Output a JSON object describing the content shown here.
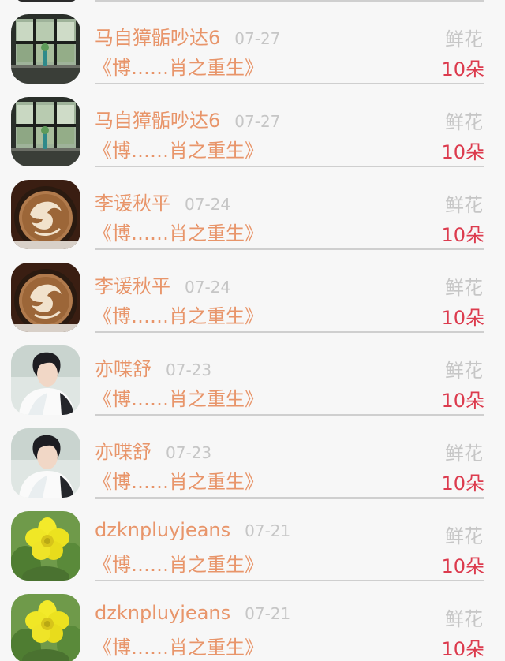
{
  "list": {
    "items": [
      {
        "name": "马自獐骺吵达6",
        "date": "07-27",
        "title": "《博……肖之重生》",
        "gift": "鲜花",
        "amount": "10朵",
        "avatar_icon": "window-plant-avatar"
      },
      {
        "name": "马自獐骺吵达6",
        "date": "07-27",
        "title": "《博……肖之重生》",
        "gift": "鲜花",
        "amount": "10朵",
        "avatar_icon": "window-plant-avatar"
      },
      {
        "name": "李谖秋平",
        "date": "07-24",
        "title": "《博……肖之重生》",
        "gift": "鲜花",
        "amount": "10朵",
        "avatar_icon": "latte-art-avatar"
      },
      {
        "name": "李谖秋平",
        "date": "07-24",
        "title": "《博……肖之重生》",
        "gift": "鲜花",
        "amount": "10朵",
        "avatar_icon": "latte-art-avatar"
      },
      {
        "name": "亦喋舒",
        "date": "07-23",
        "title": "《博……肖之重生》",
        "gift": "鲜花",
        "amount": "10朵",
        "avatar_icon": "portrait-avatar"
      },
      {
        "name": "亦喋舒",
        "date": "07-23",
        "title": "《博……肖之重生》",
        "gift": "鲜花",
        "amount": "10朵",
        "avatar_icon": "portrait-avatar"
      },
      {
        "name": "dzknpluyjeans",
        "date": "07-21",
        "title": "《博……肖之重生》",
        "gift": "鲜花",
        "amount": "10朵",
        "avatar_icon": "yellow-flower-avatar"
      },
      {
        "name": "dzknpluyjeans",
        "date": "07-21",
        "title": "《博……肖之重生》",
        "gift": "鲜花",
        "amount": "10朵",
        "avatar_icon": "yellow-flower-avatar"
      }
    ]
  },
  "colors": {
    "name": "#e8956a",
    "date": "#c6c6c6",
    "amount": "#dc3b4e",
    "background": "#f7f7f7"
  }
}
